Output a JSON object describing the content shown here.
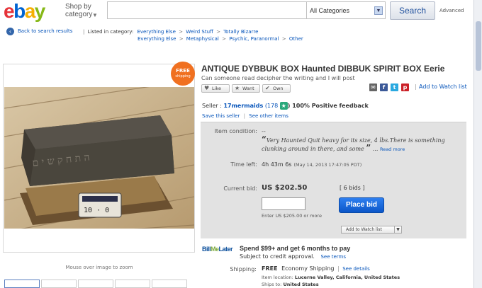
{
  "header": {
    "logo": [
      "e",
      "b",
      "a",
      "y"
    ],
    "shop_by": "Shop by",
    "category": "category",
    "search_value": "",
    "category_select": "All Categories",
    "search_button": "Search",
    "advanced": "Advanced"
  },
  "breadcrumb": {
    "back": "Back to search results",
    "listed_in": "Listed in category:",
    "row1": [
      "Everything Else",
      "Weird Stuff",
      "Totally Bizarre"
    ],
    "row2": [
      "Everything Else",
      "Metaphysical",
      "Psychic, Paranormal",
      "Other"
    ]
  },
  "badge": {
    "line1": "FREE",
    "line2": "shipping"
  },
  "image_panel": {
    "mouseover": "Mouse over image to zoom"
  },
  "item": {
    "title": "ANTIQUE DYBBUK BOX Haunted DIBBUK SPIRIT BOX Eerie",
    "subtitle": "Can someone read decipher the writing and I will post",
    "like": "Like",
    "want": "Want",
    "own": "Own",
    "add_watch": "Add to Watch list"
  },
  "seller": {
    "prefix": "Seller :",
    "name": "17mermaids",
    "score": "(178",
    "feedback": ") 100% Positive feedback",
    "save": "Save this seller",
    "other": "See other items"
  },
  "details": {
    "condition_label": "Item condition:",
    "condition_value": "--",
    "quote_text": "Very Haunted Quit heavy for its size, 4 lbs.There is something clunking around in there, and some ",
    "quote_dots": "...",
    "read_more": "Read more",
    "time_label": "Time left:",
    "time_value": "4h 43m 6s",
    "time_date": "(May 14, 2013  17:47:05 PDT)",
    "bid_label": "Current bid:",
    "bid_value": "US $202.50",
    "bids_count": "[ 6 bids ]",
    "bid_input": "",
    "place_bid": "Place bid",
    "enter_note": "Enter US $205.00 or more",
    "add_watch_btn": "Add to Watch list"
  },
  "bml": {
    "logo_a": "Bill",
    "logo_b": "Me",
    "logo_c": "Later",
    "offer": "Spend $99+ and get 6 months to pay",
    "sub": "Subject to credit approval.",
    "terms": "See terms"
  },
  "shipping": {
    "label": "Shipping:",
    "free": "FREE",
    "method": "Economy Shipping",
    "details": "See details",
    "loc_label": "Item location:",
    "loc_value": "Lucerne Valley, California, United States",
    "to_label": "Ships to:",
    "to_value": "United States"
  },
  "colors": {
    "brand_red": "#e53238",
    "brand_blue": "#0064d2",
    "brand_yellow": "#f5af02",
    "brand_green": "#86b817",
    "bid_button": "#0b56c8",
    "free_badge": "#f07020"
  }
}
